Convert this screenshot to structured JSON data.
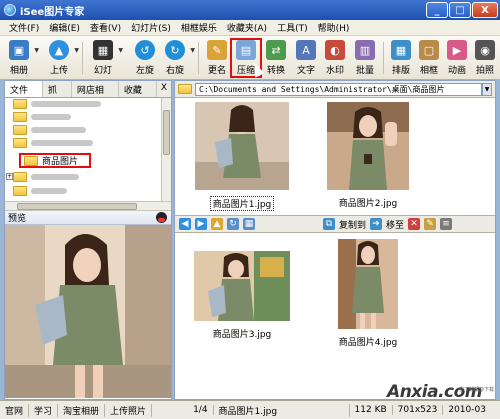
{
  "window": {
    "title": "iSee图片专家",
    "min": "_",
    "max": "□",
    "close": "X"
  },
  "menu": [
    "文件(F)",
    "编辑(E)",
    "查看(V)",
    "幻灯片(S)",
    "相框娱乐",
    "收藏夹(A)",
    "工具(T)",
    "帮助(H)"
  ],
  "toolbar": {
    "album": "相册",
    "upload": "上传",
    "slideshow": "幻灯",
    "rotate_left": "左旋",
    "rotate_right": "右旋",
    "rename": "更名",
    "compress": "压缩",
    "convert": "转换",
    "text": "文字",
    "watermark": "水印",
    "batch": "批量",
    "layout": "排版",
    "frame": "相框",
    "animation": "动画",
    "capture": "拍照"
  },
  "left_tabs": [
    "文件夹",
    "抓图",
    "网店相册",
    "收藏夹"
  ],
  "left_tab_close": "X",
  "tree": {
    "selected": "商品图片"
  },
  "preview": {
    "title": "预览"
  },
  "address": {
    "path": "C:\\Documents and Settings\\Administrator\\桌面\\商品图片"
  },
  "nav_toolbar": {
    "copy_to": "复制到",
    "move_to": "移至"
  },
  "files": [
    {
      "name": "商品图片1.jpg",
      "selected": true
    },
    {
      "name": "商品图片2.jpg",
      "selected": false
    },
    {
      "name": "商品图片3.jpg",
      "selected": false
    },
    {
      "name": "商品图片4.jpg",
      "selected": false
    }
  ],
  "status": {
    "items": [
      "官网",
      "学习",
      "淘宝相册",
      "上传照片"
    ],
    "page": "1/4",
    "file": "商品图片1.jpg",
    "size": "112 KB",
    "dims": "701x523",
    "date": "2010-03"
  },
  "watermark": {
    "brand": "Anxia.com",
    "sub": "安下载帮你下载"
  },
  "colors": {
    "title_bar": "#2a5fc8",
    "highlight": "#e01010",
    "folder": "#f0c53a"
  }
}
